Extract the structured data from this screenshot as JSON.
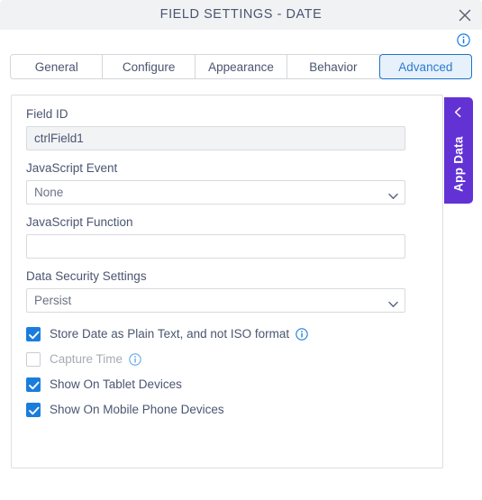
{
  "dialog": {
    "title": "FIELD SETTINGS - DATE",
    "close_icon": "close-icon",
    "header_info_icon": "info-icon"
  },
  "tabs": [
    {
      "label": "General",
      "active": false
    },
    {
      "label": "Configure",
      "active": false
    },
    {
      "label": "Appearance",
      "active": false
    },
    {
      "label": "Behavior",
      "active": false
    },
    {
      "label": "Advanced",
      "active": true
    }
  ],
  "form": {
    "field_id": {
      "label": "Field ID",
      "value": "ctrlField1",
      "placeholder": "",
      "disabled": true
    },
    "javascript_event": {
      "label": "JavaScript Event",
      "value": "None",
      "options": [
        "None"
      ]
    },
    "javascript_function": {
      "label": "JavaScript Function",
      "value": "",
      "placeholder": ""
    },
    "data_security_settings": {
      "label": "Data Security Settings",
      "value": "Persist",
      "options": [
        "Persist"
      ]
    },
    "checkboxes": [
      {
        "label": "Store Date as Plain Text, and not ISO format",
        "checked": true,
        "disabled": false,
        "has_info": true
      },
      {
        "label": "Capture Time",
        "checked": false,
        "disabled": true,
        "has_info": true
      },
      {
        "label": "Show On Tablet Devices",
        "checked": true,
        "disabled": false,
        "has_info": false
      },
      {
        "label": "Show On Mobile Phone Devices",
        "checked": true,
        "disabled": false,
        "has_info": false
      }
    ]
  },
  "app_data_tab": {
    "label": "App Data",
    "chevron_icon": "chevron-left-icon"
  },
  "colors": {
    "accent_blue": "#1a7ddb",
    "active_tab_bg": "#e7f1fb",
    "active_tab_border": "#1a73c8",
    "purple": "#6232d4",
    "titlebar_bg": "#f1f2f4",
    "text": "#4a5570"
  }
}
